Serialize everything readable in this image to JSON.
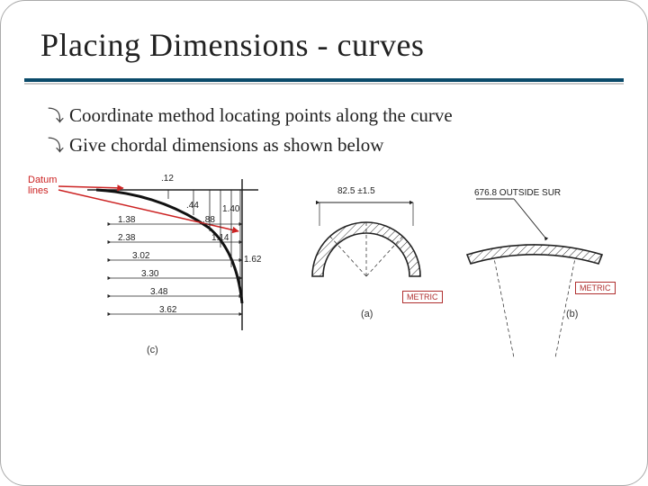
{
  "title": "Placing Dimensions - curves",
  "bullets": [
    "Coordinate method locating points along the curve",
    "Give chordal dimensions as shown below"
  ],
  "fig_c": {
    "datum_label": "Datum\nlines",
    "y_values": [
      ".12",
      ".44",
      ".88",
      "1.14",
      "1.40",
      "1.62"
    ],
    "x_values": [
      "1.38",
      "2.38",
      "3.02",
      "3.30",
      "3.48",
      "3.62"
    ],
    "caption": "(c)"
  },
  "fig_a": {
    "chord": "82.5 ±1.5",
    "caption": "(a)",
    "metric": "METRIC"
  },
  "fig_b": {
    "radius": "676.8 OUTSIDE SUR",
    "caption": "(b)",
    "metric": "METRIC"
  }
}
